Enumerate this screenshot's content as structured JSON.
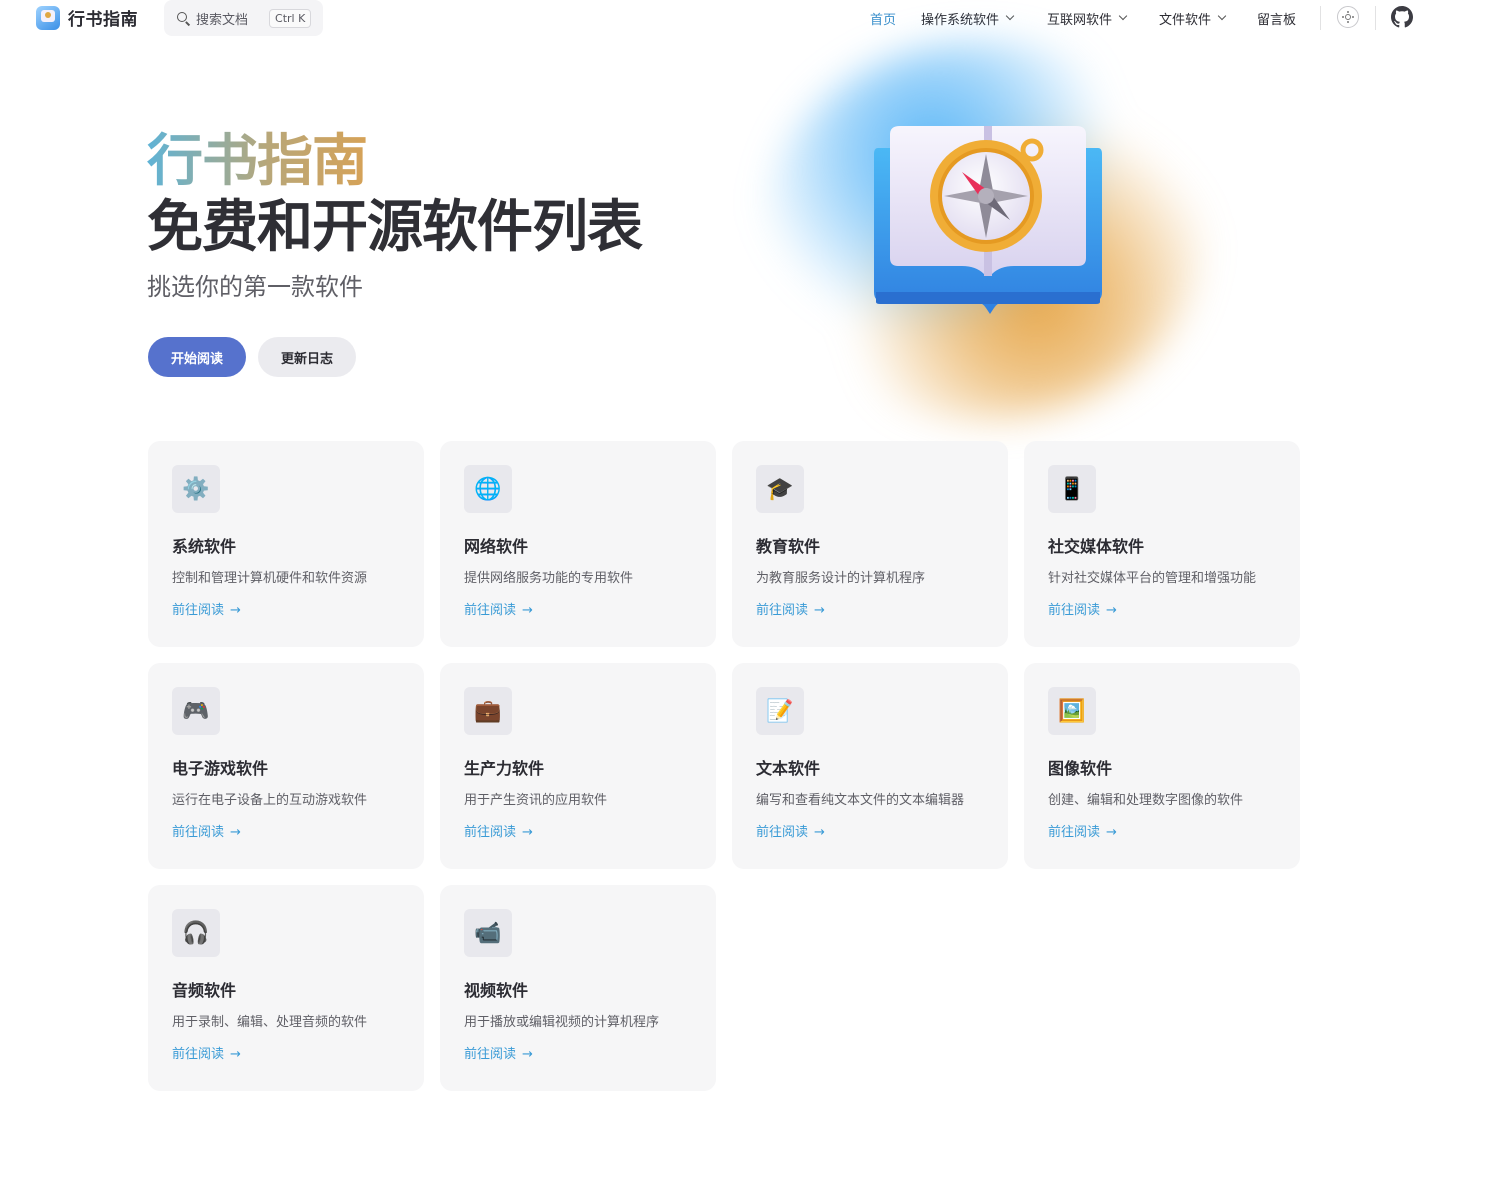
{
  "nav": {
    "title": "行书指南",
    "search_label": "搜索文档",
    "search_key": "Ctrl K",
    "items": [
      {
        "label": "首页",
        "active": true,
        "dropdown": false
      },
      {
        "label": "操作系统软件",
        "active": false,
        "dropdown": true
      },
      {
        "label": "互联网软件",
        "active": false,
        "dropdown": true
      },
      {
        "label": "文件软件",
        "active": false,
        "dropdown": true
      },
      {
        "label": "留言板",
        "active": false,
        "dropdown": false
      }
    ],
    "theme_icon": "sun-icon",
    "github_icon": "github-icon"
  },
  "hero": {
    "name": "行书指南",
    "text": "免费和开源软件列表",
    "tagline": "挑选你的第一款软件",
    "actions": [
      {
        "label": "开始阅读",
        "theme": "brand"
      },
      {
        "label": "更新日志",
        "theme": "alt"
      }
    ],
    "image": "book-compass-illustration"
  },
  "features": [
    {
      "icon": "⚙️",
      "icon_name": "gear-icon",
      "title": "系统软件",
      "details": "控制和管理计算机硬件和软件资源",
      "link": "前往阅读"
    },
    {
      "icon": "🌐",
      "icon_name": "globe-icon",
      "title": "网络软件",
      "details": "提供网络服务功能的专用软件",
      "link": "前往阅读"
    },
    {
      "icon": "🎓",
      "icon_name": "graduation-cap-icon",
      "title": "教育软件",
      "details": "为教育服务设计的计算机程序",
      "link": "前往阅读"
    },
    {
      "icon": "📱",
      "icon_name": "phone-icon",
      "title": "社交媒体软件",
      "details": "针对社交媒体平台的管理和增强功能",
      "link": "前往阅读"
    },
    {
      "icon": "🎮",
      "icon_name": "gamepad-icon",
      "title": "电子游戏软件",
      "details": "运行在电子设备上的互动游戏软件",
      "link": "前往阅读"
    },
    {
      "icon": "💼",
      "icon_name": "briefcase-icon",
      "title": "生产力软件",
      "details": "用于产生资讯的应用软件",
      "link": "前往阅读"
    },
    {
      "icon": "📝",
      "icon_name": "memo-icon",
      "title": "文本软件",
      "details": "编写和查看纯文本文件的文本编辑器",
      "link": "前往阅读"
    },
    {
      "icon": "🖼️",
      "icon_name": "picture-icon",
      "title": "图像软件",
      "details": "创建、编辑和处理数字图像的软件",
      "link": "前往阅读"
    },
    {
      "icon": "🎧",
      "icon_name": "headphones-icon",
      "title": "音频软件",
      "details": "用于录制、编辑、处理音频的软件",
      "link": "前往阅读"
    },
    {
      "icon": "📹",
      "icon_name": "video-camera-icon",
      "title": "视频软件",
      "details": "用于播放或编辑视频的计算机程序",
      "link": "前往阅读"
    }
  ]
}
